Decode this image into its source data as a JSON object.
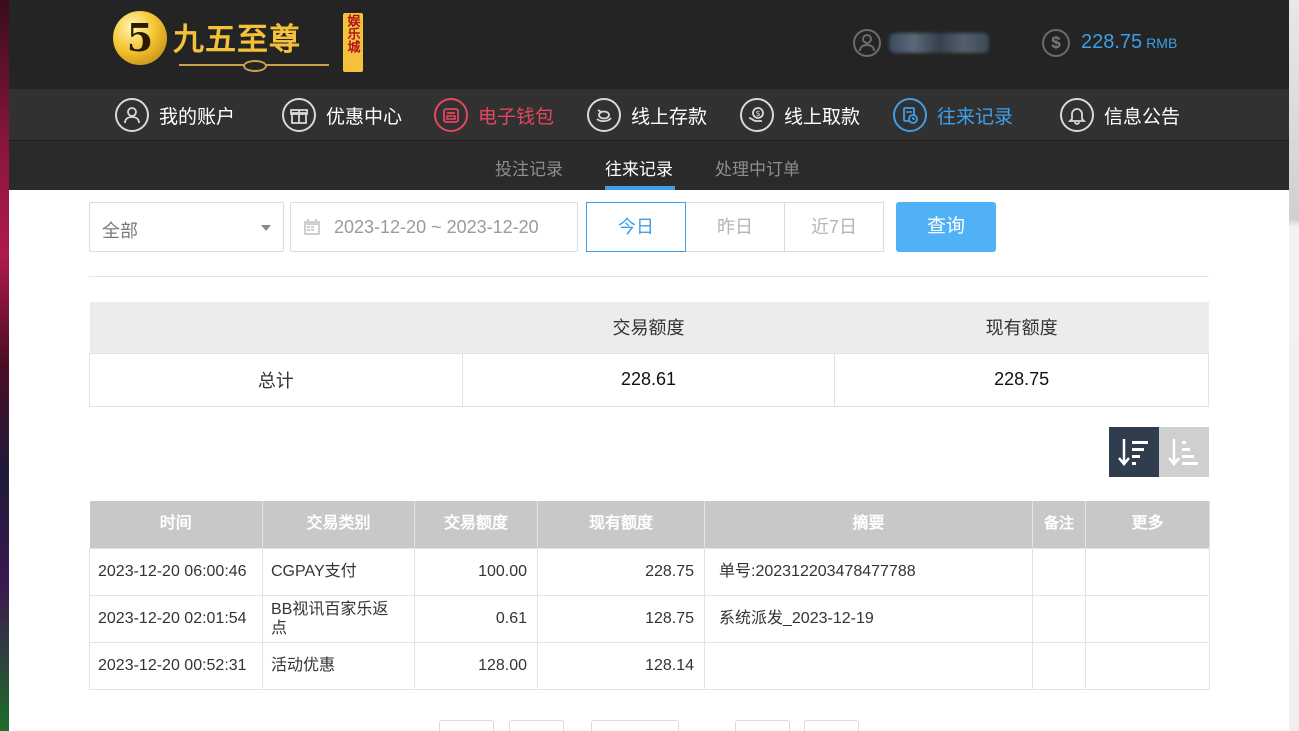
{
  "brand": {
    "name": "九五至尊",
    "badge": "娱乐城",
    "emblem": "5"
  },
  "header": {
    "balance": "228.75",
    "currency": "RMB",
    "icons": [
      "user-icon",
      "dollar-coin-icon"
    ]
  },
  "nav": {
    "items": [
      {
        "label": "我的账户",
        "icon": "user-circle-icon"
      },
      {
        "label": "优惠中心",
        "icon": "gift-icon"
      },
      {
        "label": "电子钱包",
        "icon": "wallet-icon"
      },
      {
        "label": "线上存款",
        "icon": "deposit-icon"
      },
      {
        "label": "线上取款",
        "icon": "withdraw-icon"
      },
      {
        "label": "往来记录",
        "icon": "record-icon"
      },
      {
        "label": "信息公告",
        "icon": "bell-icon"
      }
    ],
    "active": "往来记录",
    "highlight": "电子钱包"
  },
  "subnav": {
    "items": [
      "投注记录",
      "往来记录",
      "处理中订单"
    ],
    "active": "往来记录"
  },
  "filters": {
    "type_value": "全部",
    "date_range": "2023-12-20 ~ 2023-12-20",
    "quick": [
      "今日",
      "昨日",
      "近7日"
    ],
    "quick_active": "今日",
    "search_label": "查询"
  },
  "summary": {
    "headers": [
      "",
      "交易额度",
      "现有额度"
    ],
    "row": {
      "label": "总计",
      "amount": "228.61",
      "balance": "228.75"
    }
  },
  "records": {
    "headers": [
      "时间",
      "交易类别",
      "交易额度",
      "现有额度",
      "摘要",
      "备注",
      "更多"
    ],
    "rows": [
      [
        "2023-12-20 06:00:46",
        "CGPAY支付",
        "100.00",
        "228.75",
        "单号:202312203478477788",
        "",
        ""
      ],
      [
        "2023-12-20 02:01:54",
        "BB视讯百家乐返点",
        "0.61",
        "128.75",
        "系统派发_2023-12-19",
        "",
        ""
      ],
      [
        "2023-12-20 00:52:31",
        "活动优惠",
        "128.00",
        "128.14",
        "",
        "",
        ""
      ]
    ]
  },
  "colors": {
    "accent": "#3e9ee7",
    "highlight": "#e6475e",
    "gold": "#f3c23a",
    "search_button": "#51b1f6",
    "header_bg": "#242424"
  }
}
